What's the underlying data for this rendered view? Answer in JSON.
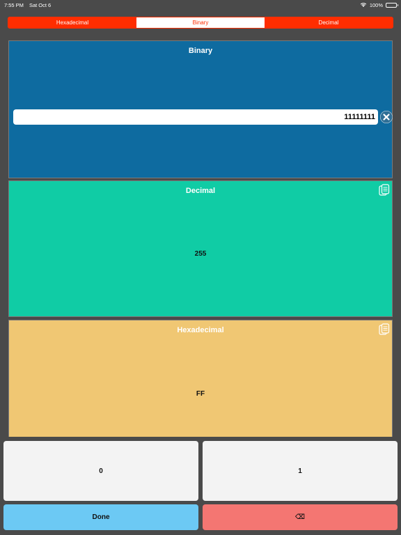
{
  "status_bar": {
    "time": "7:55 PM",
    "date": "Sat Oct 6",
    "battery": "100%"
  },
  "segmented": {
    "items": [
      "Hexadecimal",
      "Binary",
      "Decimal"
    ],
    "selected": "Binary"
  },
  "binary": {
    "title": "Binary",
    "value": "11111111"
  },
  "decimal": {
    "title": "Decimal",
    "value": "255"
  },
  "hexadecimal": {
    "title": "Hexadecimal",
    "value": "FF"
  },
  "keypad": {
    "zero": "0",
    "one": "1",
    "done": "Done",
    "backspace": "⌫"
  },
  "colors": {
    "accent": "#ff2d00",
    "binary_panel": "#0e6ba0",
    "decimal_panel": "#10cca5",
    "hex_panel": "#f0c773",
    "done_key": "#6cc9f4",
    "backspace_key": "#f47672"
  },
  "icons": {
    "clear": "clear-circle-icon",
    "copy": "copy-icon",
    "wifi": "wifi-icon",
    "battery": "battery-icon"
  }
}
